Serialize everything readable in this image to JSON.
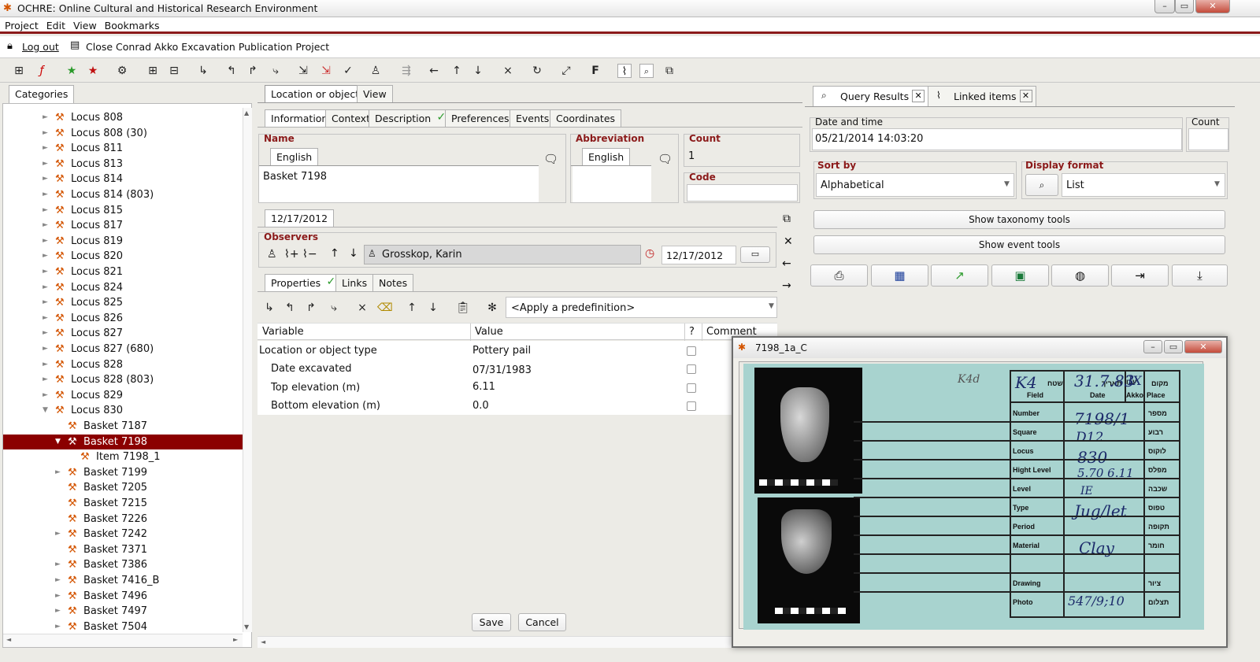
{
  "window": {
    "title": "OCHRE: Online Cultural and Historical Research Environment"
  },
  "menu": [
    "Project",
    "Edit",
    "View",
    "Bookmarks"
  ],
  "project_bar": {
    "logout": "Log out",
    "close_project": "Close Conrad Akko Excavation Publication Project"
  },
  "left": {
    "tab": "Categories",
    "tree": [
      {
        "label": "Locus 808",
        "level": 0,
        "arrow": "►"
      },
      {
        "label": "Locus 808 (30)",
        "level": 0,
        "arrow": "►"
      },
      {
        "label": "Locus 811",
        "level": 0,
        "arrow": "►"
      },
      {
        "label": "Locus 813",
        "level": 0,
        "arrow": "►"
      },
      {
        "label": "Locus 814",
        "level": 0,
        "arrow": "►"
      },
      {
        "label": "Locus 814 (803)",
        "level": 0,
        "arrow": "►"
      },
      {
        "label": "Locus 815",
        "level": 0,
        "arrow": "►"
      },
      {
        "label": "Locus 817",
        "level": 0,
        "arrow": "►"
      },
      {
        "label": "Locus 819",
        "level": 0,
        "arrow": "►"
      },
      {
        "label": "Locus 820",
        "level": 0,
        "arrow": "►"
      },
      {
        "label": "Locus 821",
        "level": 0,
        "arrow": "►"
      },
      {
        "label": "Locus 824",
        "level": 0,
        "arrow": "►"
      },
      {
        "label": "Locus 825",
        "level": 0,
        "arrow": "►"
      },
      {
        "label": "Locus 826",
        "level": 0,
        "arrow": "►"
      },
      {
        "label": "Locus 827",
        "level": 0,
        "arrow": "►"
      },
      {
        "label": "Locus 827 (680)",
        "level": 0,
        "arrow": "►"
      },
      {
        "label": "Locus 828",
        "level": 0,
        "arrow": "►"
      },
      {
        "label": "Locus 828 (803)",
        "level": 0,
        "arrow": "►"
      },
      {
        "label": "Locus 829",
        "level": 0,
        "arrow": "►"
      },
      {
        "label": "Locus 830",
        "level": 0,
        "arrow": "▼"
      },
      {
        "label": "Basket 7187",
        "level": 1,
        "arrow": ""
      },
      {
        "label": "Basket 7198",
        "level": 1,
        "arrow": "▼",
        "selected": true
      },
      {
        "label": "Item 7198_1",
        "level": 2,
        "arrow": ""
      },
      {
        "label": "Basket 7199",
        "level": 1,
        "arrow": "►"
      },
      {
        "label": "Basket 7205",
        "level": 1,
        "arrow": ""
      },
      {
        "label": "Basket 7215",
        "level": 1,
        "arrow": ""
      },
      {
        "label": "Basket 7226",
        "level": 1,
        "arrow": ""
      },
      {
        "label": "Basket 7242",
        "level": 1,
        "arrow": "►"
      },
      {
        "label": "Basket 7371",
        "level": 1,
        "arrow": ""
      },
      {
        "label": "Basket 7386",
        "level": 1,
        "arrow": "►"
      },
      {
        "label": "Basket 7416_B",
        "level": 1,
        "arrow": "►"
      },
      {
        "label": "Basket 7496",
        "level": 1,
        "arrow": "►"
      },
      {
        "label": "Basket 7497",
        "level": 1,
        "arrow": "►"
      },
      {
        "label": "Basket 7504",
        "level": 1,
        "arrow": "►"
      }
    ]
  },
  "middle": {
    "top_tabs": [
      "Location or object",
      "View"
    ],
    "sub_tabs": [
      "Information",
      "Context",
      "Description",
      "Preferences",
      "Events",
      "Coordinates"
    ],
    "name": {
      "label": "Name",
      "lang_tab": "English",
      "value": "Basket 7198"
    },
    "abbreviation": {
      "label": "Abbreviation",
      "lang_tab": "English"
    },
    "count": {
      "label": "Count",
      "value": "1"
    },
    "code": {
      "label": "Code"
    },
    "date_tab": "12/17/2012",
    "observers": {
      "label": "Observers",
      "name": "Grosskop, Karin",
      "date": "12/17/2012"
    },
    "prop_tabs": [
      "Properties",
      "Links",
      "Notes"
    ],
    "predefinition": "<Apply a predefinition>",
    "table_headers": {
      "variable": "Variable",
      "value": "Value",
      "q": "?",
      "comment": "Comment"
    },
    "rows": [
      {
        "variable": "Location or object type",
        "value": "Pottery pail"
      },
      {
        "variable": "Date excavated",
        "value": "07/31/1983"
      },
      {
        "variable": "Top elevation (m)",
        "value": "6.11"
      },
      {
        "variable": "Bottom elevation (m)",
        "value": "0.0"
      }
    ],
    "save": "Save",
    "cancel": "Cancel"
  },
  "right": {
    "tabs": [
      "Query Results",
      "Linked items"
    ],
    "date_time": {
      "label": "Date and time",
      "value": "05/21/2014 14:03:20"
    },
    "count_label": "Count",
    "sort_by": {
      "label": "Sort by",
      "value": "Alphabetical"
    },
    "display_format": {
      "label": "Display format",
      "value": "List"
    },
    "show_taxonomy": "Show taxonomy tools",
    "show_event": "Show event tools"
  },
  "image_window": {
    "title": "7198_1a_C",
    "card": {
      "handwritten": {
        "k4d": "K4d",
        "field": "K4",
        "date": "31.7.83",
        "place": "IX",
        "number": "7198/1",
        "square": "D12",
        "locus": "830",
        "level_val": "IE",
        "hight": "5.70  6.11",
        "type": "Jug/let",
        "material": "Clay",
        "photo": "547/9;10"
      },
      "header": {
        "field": "Field",
        "date": "Date",
        "akko": "Akko",
        "place": "Place",
        "field_he": "שטח",
        "date_he": "תאריך",
        "akko_he": "עכו",
        "place_he": "מקום"
      },
      "rows": [
        "Number",
        "Square",
        "Locus",
        "Hight Level",
        "Level",
        "Type",
        "Period",
        "Material",
        "",
        "Drawing",
        "Photo"
      ],
      "rows_he": [
        "מספר",
        "רבוע",
        "לוקוס",
        "מפלס",
        "שכבה",
        "טפוס",
        "תקופה",
        "חומר",
        "",
        "ציור",
        "תצלום"
      ]
    }
  }
}
